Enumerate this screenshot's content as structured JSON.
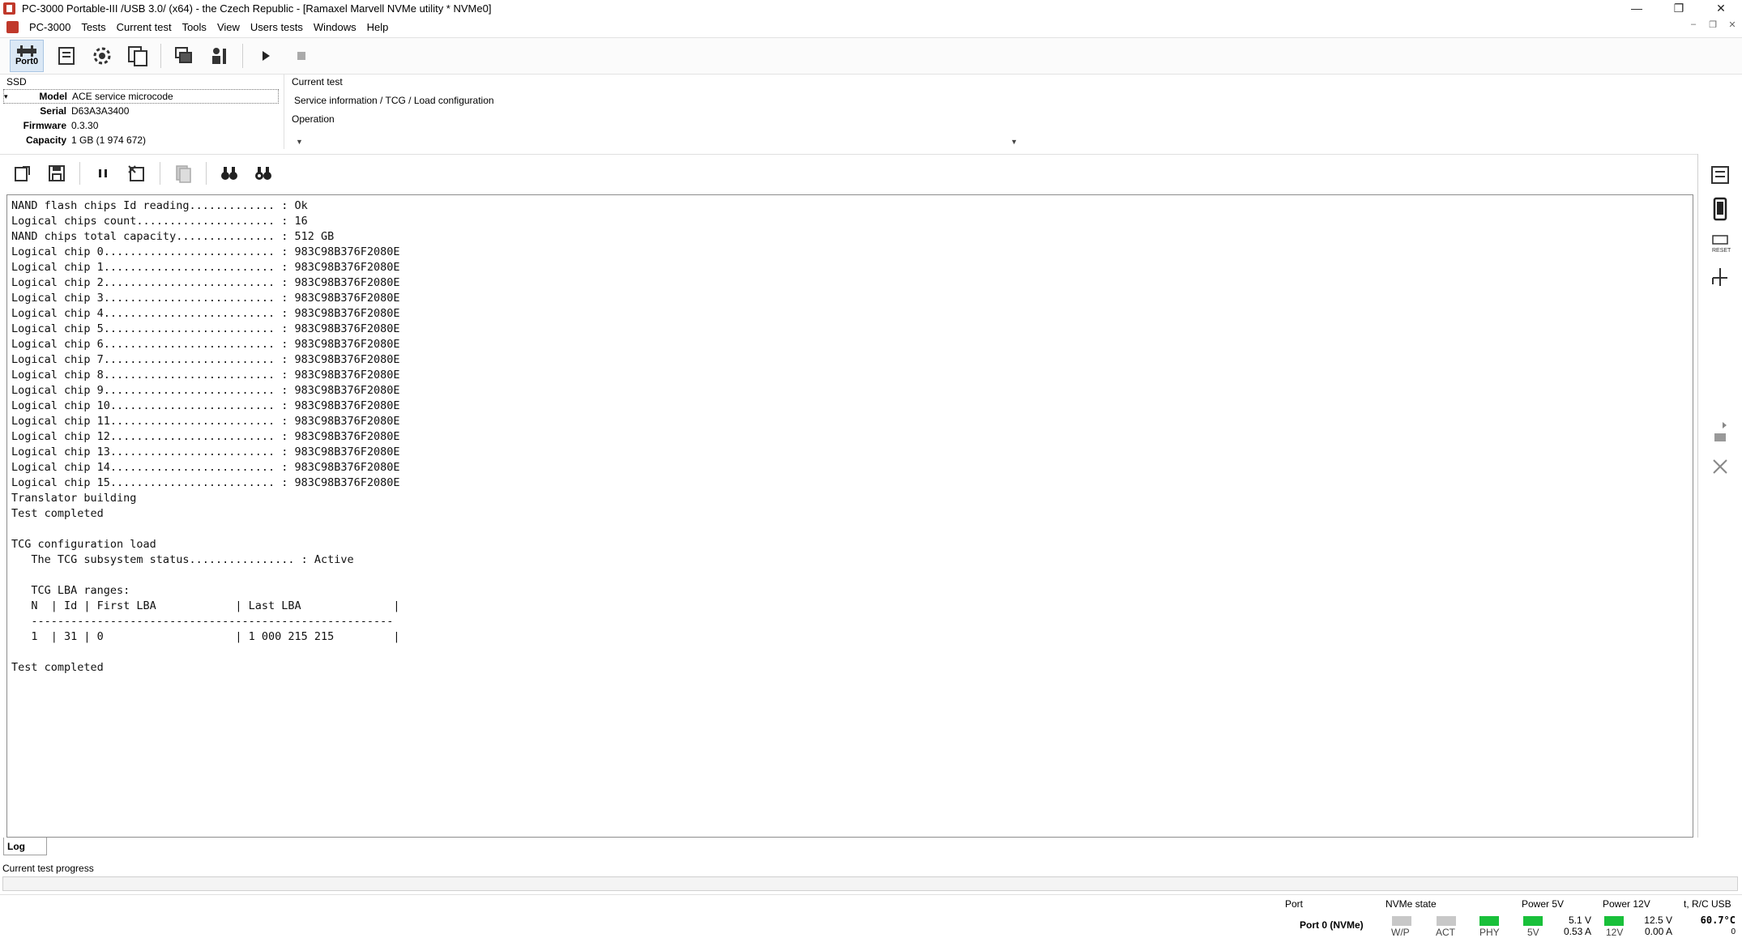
{
  "window": {
    "title": "PC-3000 Portable-III /USB 3.0/ (x64) - the Czech Republic - [Ramaxel Marvell NVMe utility * NVMe0]",
    "controls": {
      "minimize": "—",
      "restore": "❐",
      "close": "✕"
    }
  },
  "menu": {
    "items": [
      "PC-3000",
      "Tests",
      "Current test",
      "Tools",
      "View",
      "Users tests",
      "Windows",
      "Help"
    ],
    "mdi_controls": {
      "minimize": "–",
      "restore": "❐",
      "close": "✕"
    }
  },
  "toolbar": {
    "port_label": "Port0"
  },
  "ssd": {
    "section_label": "SSD",
    "rows": [
      {
        "key": "Model",
        "value": "ACE service microcode"
      },
      {
        "key": "Serial",
        "value": "D63A3A3400"
      },
      {
        "key": "Firmware",
        "value": "0.3.30"
      },
      {
        "key": "Capacity",
        "value": "1 GB (1 974 672)"
      }
    ]
  },
  "current_test": {
    "label": "Current test",
    "value": "Service information / TCG / Load configuration"
  },
  "operation": {
    "label": "Operation",
    "value": ""
  },
  "log": {
    "lines": [
      "NAND flash chips Id reading............. : Ok",
      "Logical chips count..................... : 16",
      "NAND chips total capacity............... : 512 GB",
      "Logical chip 0.......................... : 983C98B376F2080E",
      "Logical chip 1.......................... : 983C98B376F2080E",
      "Logical chip 2.......................... : 983C98B376F2080E",
      "Logical chip 3.......................... : 983C98B376F2080E",
      "Logical chip 4.......................... : 983C98B376F2080E",
      "Logical chip 5.......................... : 983C98B376F2080E",
      "Logical chip 6.......................... : 983C98B376F2080E",
      "Logical chip 7.......................... : 983C98B376F2080E",
      "Logical chip 8.......................... : 983C98B376F2080E",
      "Logical chip 9.......................... : 983C98B376F2080E",
      "Logical chip 10......................... : 983C98B376F2080E",
      "Logical chip 11......................... : 983C98B376F2080E",
      "Logical chip 12......................... : 983C98B376F2080E",
      "Logical chip 13......................... : 983C98B376F2080E",
      "Logical chip 14......................... : 983C98B376F2080E",
      "Logical chip 15......................... : 983C98B376F2080E",
      "Translator building",
      "Test completed",
      "",
      "TCG configuration load",
      "   The TCG subsystem status................ : Active",
      "",
      "   TCG LBA ranges:",
      "   N  | Id | First LBA            | Last LBA              |",
      "   -------------------------------------------------------",
      "   1  | 31 | 0                    | 1 000 215 215         |",
      "",
      "Test completed"
    ],
    "tab_label": "Log"
  },
  "progress": {
    "label": "Current test progress",
    "value": 0
  },
  "status": {
    "port_title": "Port",
    "port_value": "Port 0 (NVMe)",
    "nvme_title": "NVMe state",
    "nvme_leds": [
      {
        "label": "W/P",
        "color": "#c8c8c8"
      },
      {
        "label": "ACT",
        "color": "#c8c8c8"
      },
      {
        "label": "PHY",
        "color": "#19c03a"
      }
    ],
    "power5_title": "Power 5V",
    "power5_led": {
      "label": "5V",
      "color": "#19c03a"
    },
    "power5_voltage": "5.1 V",
    "power5_current": "0.53 A",
    "power12_title": "Power 12V",
    "power12_led": {
      "label": "12V",
      "color": "#19c03a"
    },
    "power12_voltage": "12.5 V",
    "power12_current": "0.00 A",
    "temp_title": "t, R/C USB",
    "temp_value": "60.7°C",
    "temp_extra": "0"
  }
}
